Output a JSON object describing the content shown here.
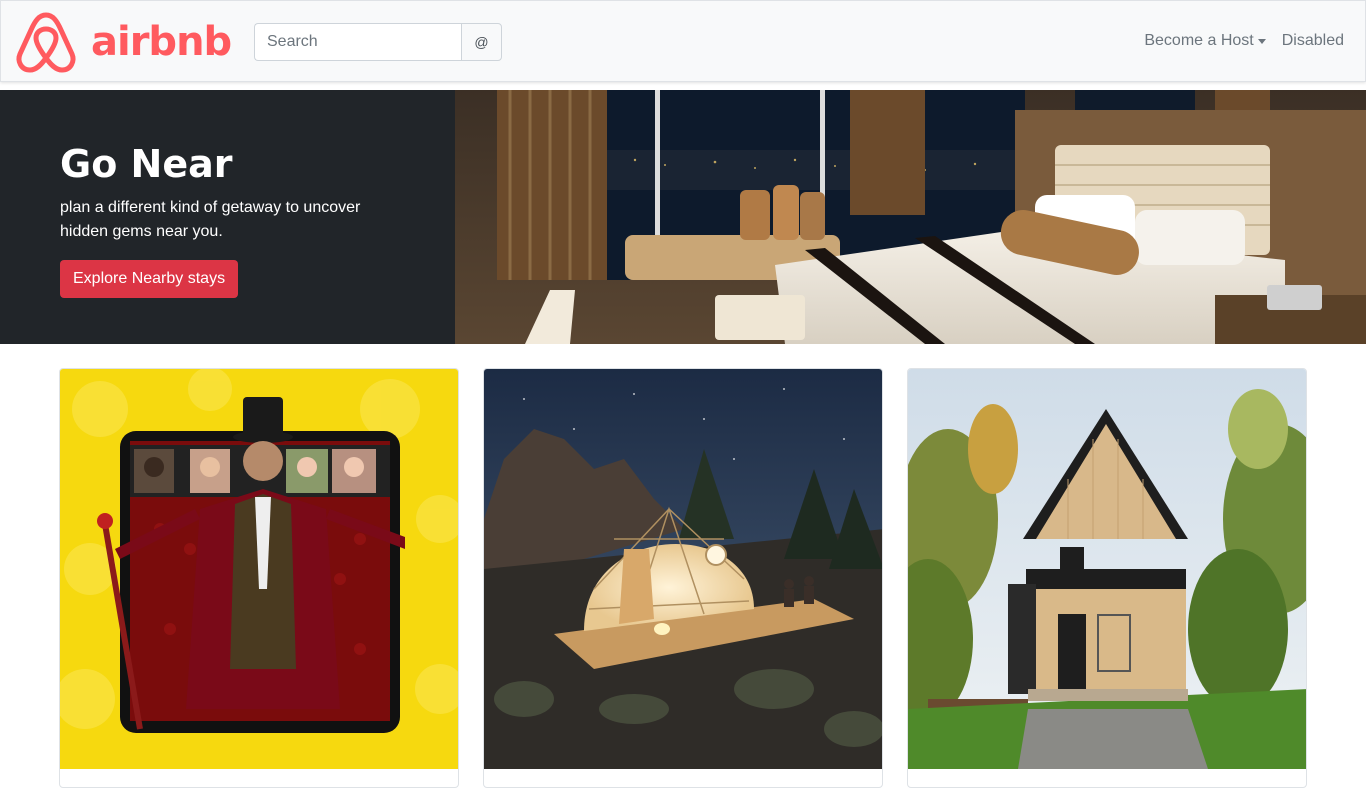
{
  "brand": {
    "name": "airbnb",
    "color": "#FF5A5F",
    "icon": "airbnb-logo-icon"
  },
  "search": {
    "placeholder": "Search",
    "button_label": "@"
  },
  "nav": {
    "host_label": "Become a Host",
    "disabled_label": "Disabled"
  },
  "hero": {
    "title": "Go Near",
    "subtitle": "plan a different kind of getaway to uncover hidden gems near you.",
    "button_label": "Explore Nearby stays",
    "button_color": "#dc3545",
    "image": "hotel-bedroom-night-view"
  },
  "cards": [
    {
      "image": "online-experience-ringmaster"
    },
    {
      "image": "glowing-dome-tent-night"
    },
    {
      "image": "a-frame-wooden-cabin"
    }
  ]
}
